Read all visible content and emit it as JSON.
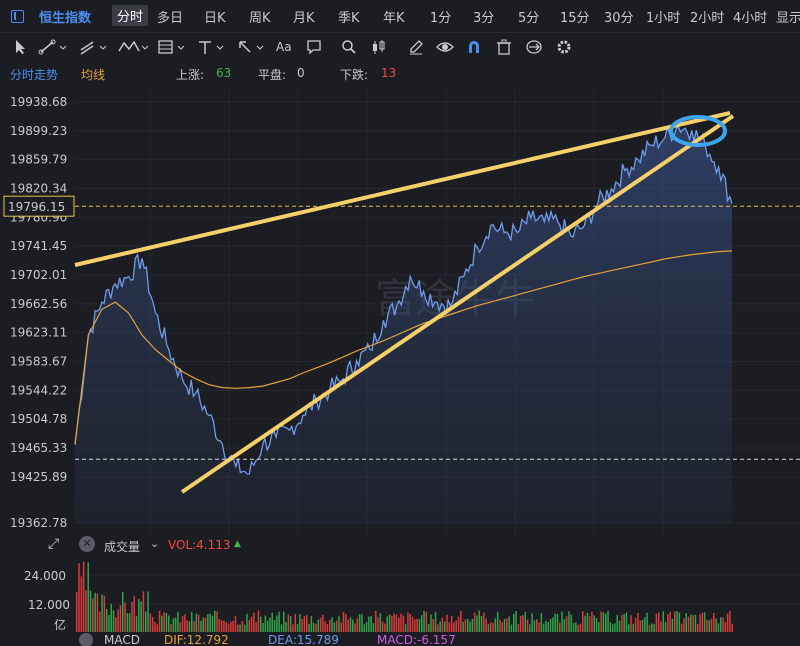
{
  "symbol": {
    "name": "恒生指数",
    "icon": "chart-panel-icon"
  },
  "timeframes": [
    {
      "label": "分时",
      "active": true
    },
    {
      "label": "多日"
    },
    {
      "label": "日K"
    },
    {
      "label": "周K"
    },
    {
      "label": "月K"
    },
    {
      "label": "季K"
    },
    {
      "label": "年K"
    },
    {
      "label": "1分"
    },
    {
      "label": "3分"
    },
    {
      "label": "5分"
    },
    {
      "label": "15分"
    },
    {
      "label": "30分"
    },
    {
      "label": "1小时"
    },
    {
      "label": "2小时"
    },
    {
      "label": "4小时"
    },
    {
      "label": "显示"
    }
  ],
  "toolbar": {
    "icons": [
      "cursor-icon",
      "line-tool-icon",
      "channel-tool-icon",
      "wave-tool-icon",
      "fib-tool-icon",
      "horizontal-line-icon",
      "arrow-tool-icon",
      "text-tool-icon",
      "comment-tool-icon",
      "search-icon",
      "candlestick-icon",
      "pencil-icon",
      "eye-icon",
      "magnet-icon",
      "trash-icon",
      "sync-icon",
      "gear-icon"
    ],
    "text_tool_label": "Aa"
  },
  "legend": {
    "mode_label": "分时走势",
    "avg_label": "均线",
    "up_label": "上涨:",
    "up_value": "63",
    "flat_label": "平盘:",
    "flat_value": "0",
    "down_label": "下跌:",
    "down_value": "13"
  },
  "colors": {
    "price_line": "#6f9bea",
    "avg_line": "#e6a23c",
    "trendline": "#f5d06a",
    "ellipse": "#3ea6f0",
    "up": "#3fb950",
    "down": "#f04848",
    "accent": "#4c8ef0"
  },
  "chart_data": {
    "type": "line",
    "y_ticks": [
      "19938.68",
      "19899.23",
      "19859.79",
      "19820.34",
      "19780.90",
      "19741.45",
      "19702.01",
      "19662.56",
      "19623.11",
      "19583.67",
      "19544.22",
      "19504.78",
      "19465.33",
      "19425.89",
      "19362.78"
    ],
    "current_price": "19796.15",
    "ylim": [
      19362.78,
      19938.68
    ],
    "series": [
      {
        "name": "分时走势",
        "values": [
          19470,
          19620,
          19665,
          19690,
          19700,
          19725,
          19650,
          19600,
          19560,
          19540,
          19510,
          19470,
          19440,
          19430,
          19470,
          19480,
          19490,
          19510,
          19530,
          19545,
          19560,
          19585,
          19600,
          19640,
          19660,
          19700,
          19680,
          19665,
          19660,
          19700,
          19740,
          19770,
          19760,
          19760,
          19780,
          19775,
          19775,
          19755,
          19770,
          19800,
          19820,
          19845,
          19860,
          19880,
          19890,
          19905,
          19900,
          19880,
          19850,
          19800
        ]
      },
      {
        "name": "均线",
        "values": [
          19470,
          19620,
          19655,
          19665,
          19650,
          19620,
          19600,
          19585,
          19570,
          19560,
          19552,
          19548,
          19547,
          19548,
          19550,
          19555,
          19560,
          19568,
          19575,
          19582,
          19590,
          19598,
          19605,
          19612,
          19620,
          19628,
          19636,
          19642,
          19648,
          19654,
          19660,
          19665,
          19670,
          19675,
          19680,
          19685,
          19690,
          19695,
          19700,
          19704,
          19708,
          19712,
          19716,
          19720,
          19724,
          19727,
          19730,
          19732,
          19734,
          19735
        ]
      }
    ],
    "volume": {
      "y_ticks": [
        "24.000",
        "12.000"
      ],
      "unit": "亿",
      "vol_label": "VOL:4.113",
      "header_label": "成交量"
    },
    "macd": {
      "label": "MACD",
      "dif": "DIF:12.792",
      "dea": "DEA:15.789",
      "macd": "MACD:-6.157"
    }
  },
  "watermark": "富途牛牛"
}
